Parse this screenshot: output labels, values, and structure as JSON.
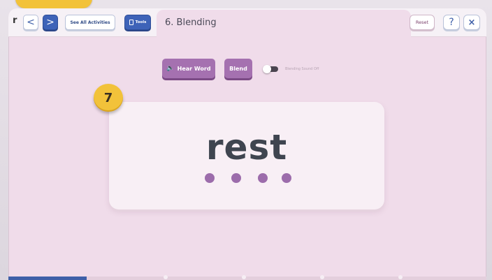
{
  "topbar": {
    "fragment": "r",
    "prev_glyph": "<",
    "next_glyph": ">",
    "see_all": "See All Activities",
    "tools": "Tools",
    "title": "6. Blending",
    "reset": "Reset",
    "help": "?",
    "close": "×"
  },
  "controls": {
    "hear_word": "Hear Word",
    "speaker_glyph": "🔈",
    "blend": "Blend",
    "toggle_label": "Blending Sound Off",
    "toggle_on": false
  },
  "card": {
    "badge": "7",
    "word": "rest",
    "dot_count": 4
  },
  "colors": {
    "brand_blue": "#3e63b8",
    "accent_purple": "#a571b0",
    "badge_yellow": "#f2c23a"
  }
}
